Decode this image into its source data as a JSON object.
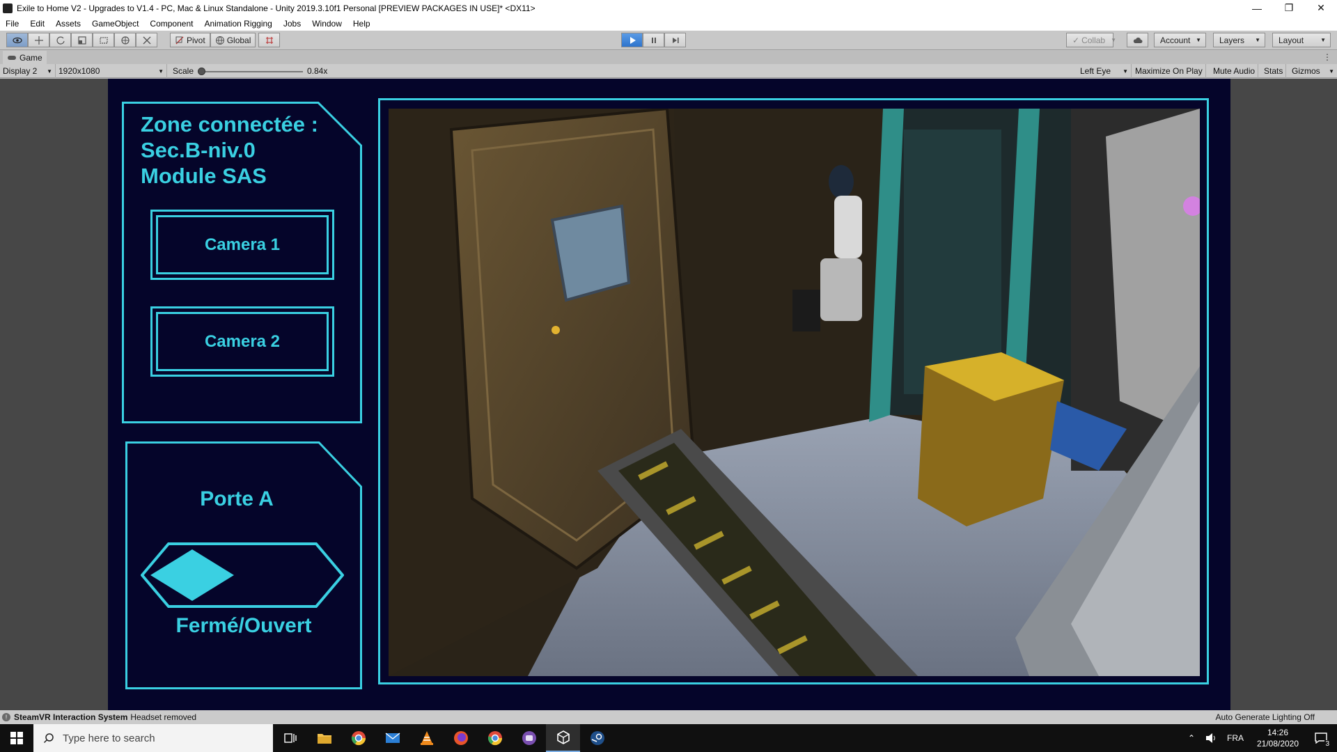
{
  "window": {
    "title": "Exile to Home V2 - Upgrades to V1.4 - PC, Mac & Linux Standalone - Unity 2019.3.10f1 Personal [PREVIEW PACKAGES IN USE]* <DX11>",
    "minimize": "—",
    "maximize": "❐",
    "close": "✕"
  },
  "menu": [
    "File",
    "Edit",
    "Assets",
    "GameObject",
    "Component",
    "Animation Rigging",
    "Jobs",
    "Window",
    "Help"
  ],
  "toolbar": {
    "pivot_label": "Pivot",
    "global_label": "Global",
    "collab_label": "Collab",
    "account_label": "Account",
    "layers_label": "Layers",
    "layout_label": "Layout"
  },
  "game_tab": {
    "label": "Game",
    "menu_dots": "⋮"
  },
  "game_toolbar": {
    "display": "Display 2",
    "resolution": "1920x1080",
    "scale_label": "Scale",
    "scale_value": "0.84x",
    "eye": "Left Eye",
    "maximize_on_play": "Maximize On Play",
    "mute_audio": "Mute Audio",
    "stats": "Stats",
    "gizmos": "Gizmos"
  },
  "hud": {
    "zone_line1": "Zone connectée :",
    "zone_line2": "Sec.B-niv.0",
    "zone_line3": "Module SAS",
    "camera1": "Camera 1",
    "camera2": "Camera 2",
    "door_title": "Porte A",
    "door_toggle_label": "Fermé/Ouvert",
    "door_state": 0
  },
  "status": {
    "source": "SteamVR Interaction System",
    "message": "Headset removed",
    "lighting": "Auto Generate Lighting Off"
  },
  "taskbar": {
    "search_placeholder": "Type here to search",
    "language": "FRA",
    "time": "14:26",
    "date": "21/08/2020",
    "notifications": "3",
    "icons": [
      "task-view-icon",
      "file-explorer-icon",
      "chrome-icon",
      "mail-icon",
      "vlc-icon",
      "firefox-icon",
      "chrome-alt-icon",
      "purple-app-icon",
      "unity-icon",
      "steam-icon"
    ]
  },
  "colors": {
    "hud_cyan": "#3ad0e2",
    "hud_bg": "#05052a",
    "play_blue": "#2e74cc"
  }
}
